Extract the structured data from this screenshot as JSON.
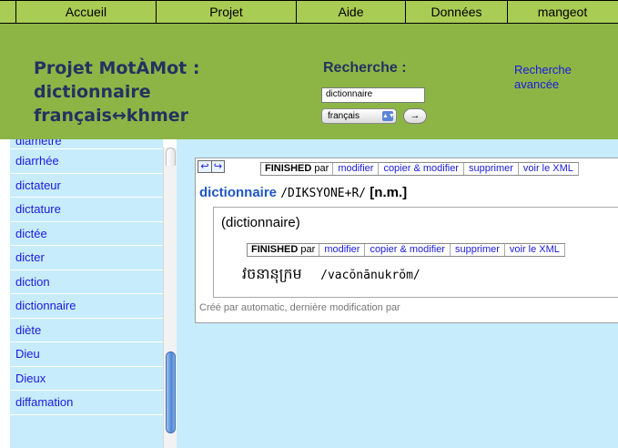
{
  "menu": {
    "items": [
      {
        "label": "Accueil",
        "width": 154
      },
      {
        "label": "Projet",
        "width": 154
      },
      {
        "label": "Aide",
        "width": 120
      },
      {
        "label": "Données",
        "width": 112
      },
      {
        "label": "mangeot",
        "width": 120
      }
    ]
  },
  "header": {
    "title_line1": "Projet MotÀMot :",
    "title_line2": "dictionnaire",
    "title_line3": "français↔khmer",
    "search_title": "Recherche :",
    "search_value": "dictionnaire",
    "language_selected": "français",
    "go_label": "→",
    "advanced_search_line1": "Recherche",
    "advanced_search_line2": "avancée"
  },
  "word_list": {
    "items": [
      "diamètre",
      "diarrhée",
      "dictateur",
      "dictature",
      "dictée",
      "dicter",
      "diction",
      "dictionnaire",
      "diète",
      "Dieu",
      "Dieux",
      "diffamation"
    ]
  },
  "entry": {
    "nav_back": "↩",
    "nav_forward": "↪",
    "status_word": "FINISHED",
    "status_suffix": "par",
    "actions": [
      "modifier",
      "copier & modifier",
      "supprimer",
      "voir le XML"
    ],
    "headword": "dictionnaire",
    "pronunciation": "/DIKSYONE+R/",
    "pos": "[n.m.]",
    "sense": {
      "gloss": "(dictionnaire)",
      "status_word": "FINISHED",
      "status_suffix": "par",
      "actions": [
        "modifier",
        "copier & modifier",
        "supprimer",
        "voir le XML"
      ],
      "khmer": "វចនានុក្រម",
      "transliteration": "/vacŏnānukrŏm/"
    },
    "meta": "Créé par automatic, dernière modification par"
  },
  "colors": {
    "menu_bg": "#a9cc55",
    "header_bg": "#8cb546",
    "title": "#23325f",
    "link": "#1a1add",
    "list_bg": "#c7ecfb",
    "headword": "#1f57c3"
  }
}
